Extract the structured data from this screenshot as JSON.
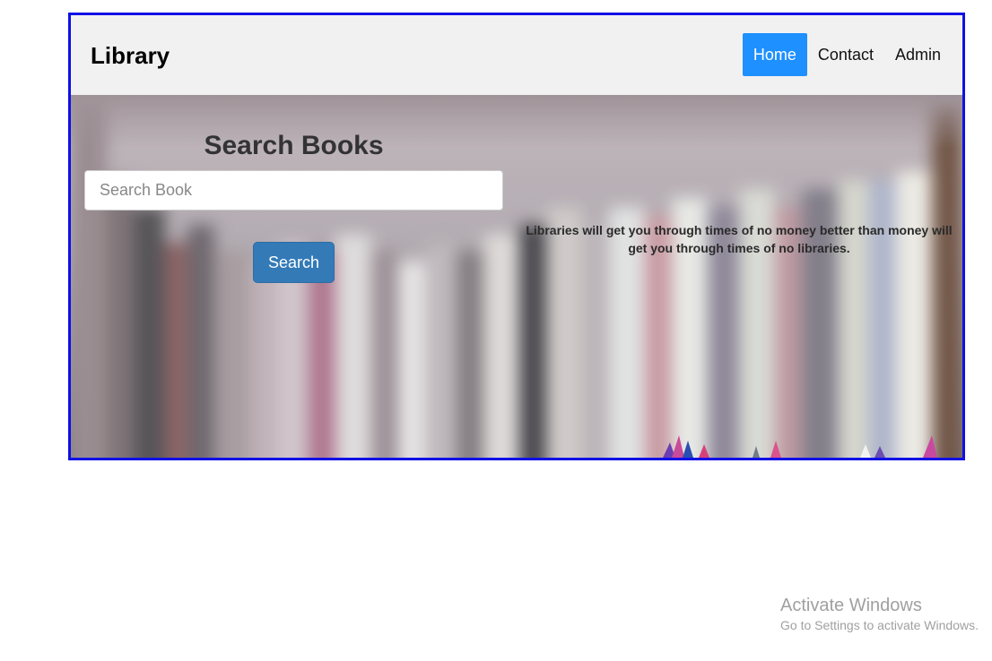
{
  "navbar": {
    "brand": "Library",
    "links": [
      {
        "label": "Home",
        "active": true
      },
      {
        "label": "Contact",
        "active": false
      },
      {
        "label": "Admin",
        "active": false
      }
    ]
  },
  "search": {
    "title": "Search Books",
    "placeholder": "Search Book",
    "value": "",
    "button_label": "Search"
  },
  "quote": {
    "text": "Libraries will get you through times of no money better than money will get you through times of no libraries."
  },
  "watermark": {
    "title": "Activate Windows",
    "subtitle": "Go to Settings to activate Windows."
  },
  "colors": {
    "frame_border": "#1010e6",
    "nav_active": "#1e90ff",
    "button": "#337ab7"
  }
}
